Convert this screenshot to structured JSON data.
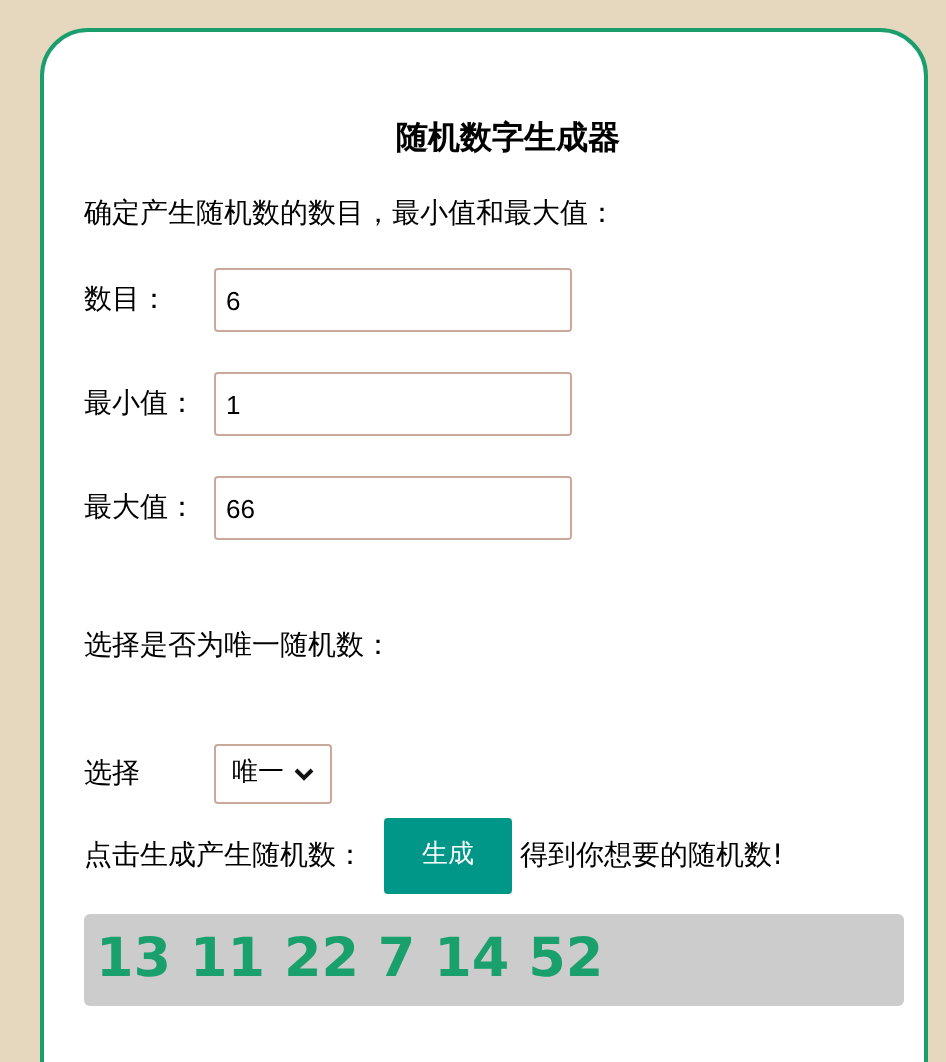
{
  "title": "随机数字生成器",
  "intro": "确定产生随机数的数目，最小值和最大值：",
  "fields": [
    {
      "label": "数目：",
      "value": "6"
    },
    {
      "label": "最小值：",
      "value": "1"
    },
    {
      "label": "最大值：",
      "value": "66"
    }
  ],
  "unique_prompt": "选择是否为唯一随机数：",
  "select": {
    "label": "选择",
    "value": "唯一"
  },
  "generate": {
    "prompt": "点击生成产生随机数：",
    "button": "生成",
    "after": "得到你想要的随机数!"
  },
  "result": "13 11 22 7 14 52"
}
